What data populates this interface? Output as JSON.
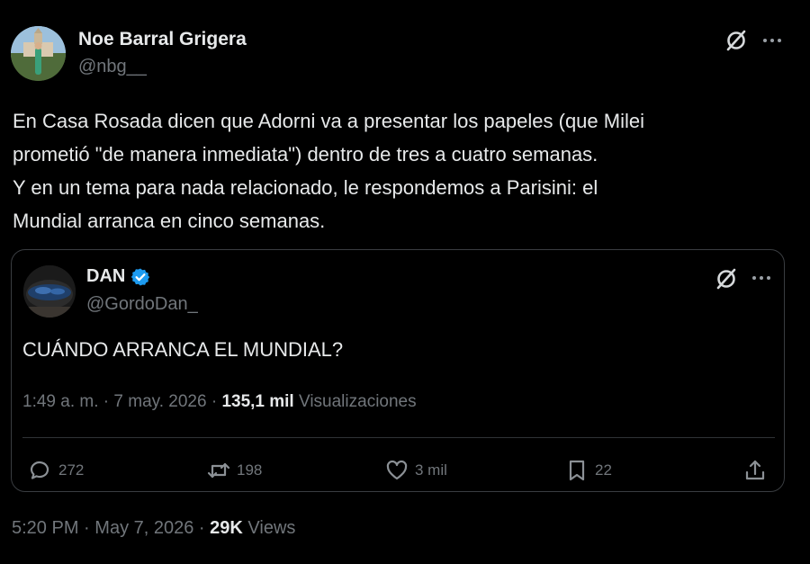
{
  "author": {
    "display_name": "Noe Barral Grigera",
    "handle": "@nbg__"
  },
  "tweet": {
    "lines": [
      "En Casa Rosada dicen que Adorni va a presentar los papeles (que Milei",
      "prometió \"de manera inmediata\") dentro de tres a cuatro semanas.",
      "Y en un tema para nada relacionado, le respondemos a Parisini: el",
      "Mundial arranca en cinco semanas."
    ]
  },
  "quote": {
    "display_name": "DAN",
    "handle": "@GordoDan_",
    "text": "CUÁNDO ARRANCA EL MUNDIAL?",
    "time": "1:49 a. m.",
    "sep1": "·",
    "date": "7 may. 2026",
    "sep2": "·",
    "views_count": "135,1 mil",
    "views_label": "Visualizaciones",
    "actions": {
      "replies": "272",
      "reposts": "198",
      "likes": "3 mil",
      "bookmarks": "22"
    }
  },
  "footer": {
    "time": "5:20 PM",
    "sep1": "·",
    "date": "May 7, 2026",
    "sep2": "·",
    "views_count": "29K",
    "views_label": "Views"
  },
  "colors": {
    "background": "#000000",
    "primary_text": "#e7e9ea",
    "secondary_text": "#71767b",
    "verified_badge": "#1d9bf0",
    "border": "#3a3d41"
  }
}
